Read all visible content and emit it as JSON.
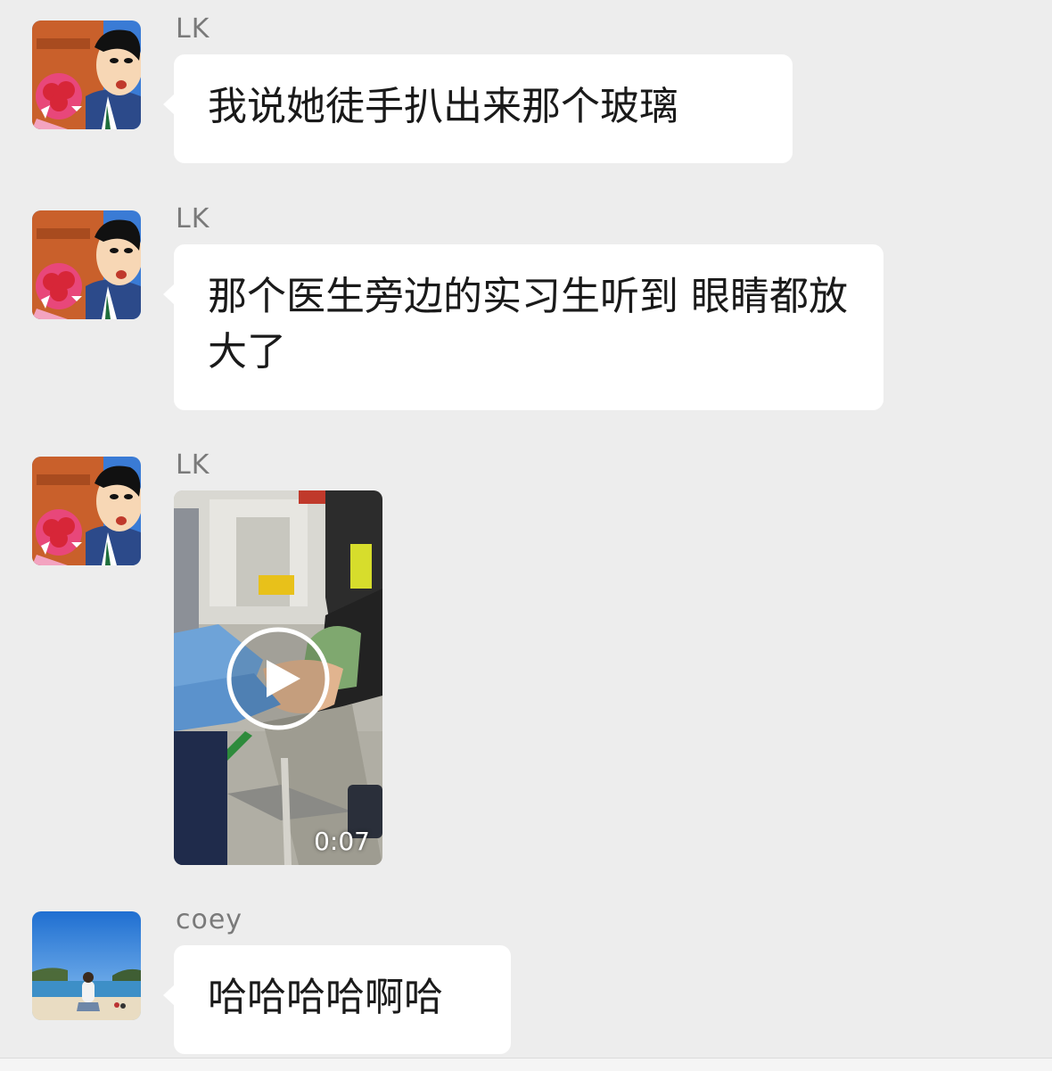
{
  "messages": [
    {
      "sender": "LK",
      "text": "我说她徒手扒出来那个玻璃"
    },
    {
      "sender": "LK",
      "text": "那个医生旁边的实习生听到 眼睛都放大了"
    },
    {
      "sender": "LK",
      "video": {
        "duration": "0:07"
      }
    },
    {
      "sender": "coey",
      "text": "哈哈哈哈啊哈"
    }
  ],
  "colors": {
    "background": "#ededed",
    "bubble": "#ffffff",
    "sender_name": "#7a7a7a",
    "text": "#1a1a1a"
  },
  "icons": [
    "avatar-cartoon",
    "avatar-beach",
    "play-icon"
  ]
}
